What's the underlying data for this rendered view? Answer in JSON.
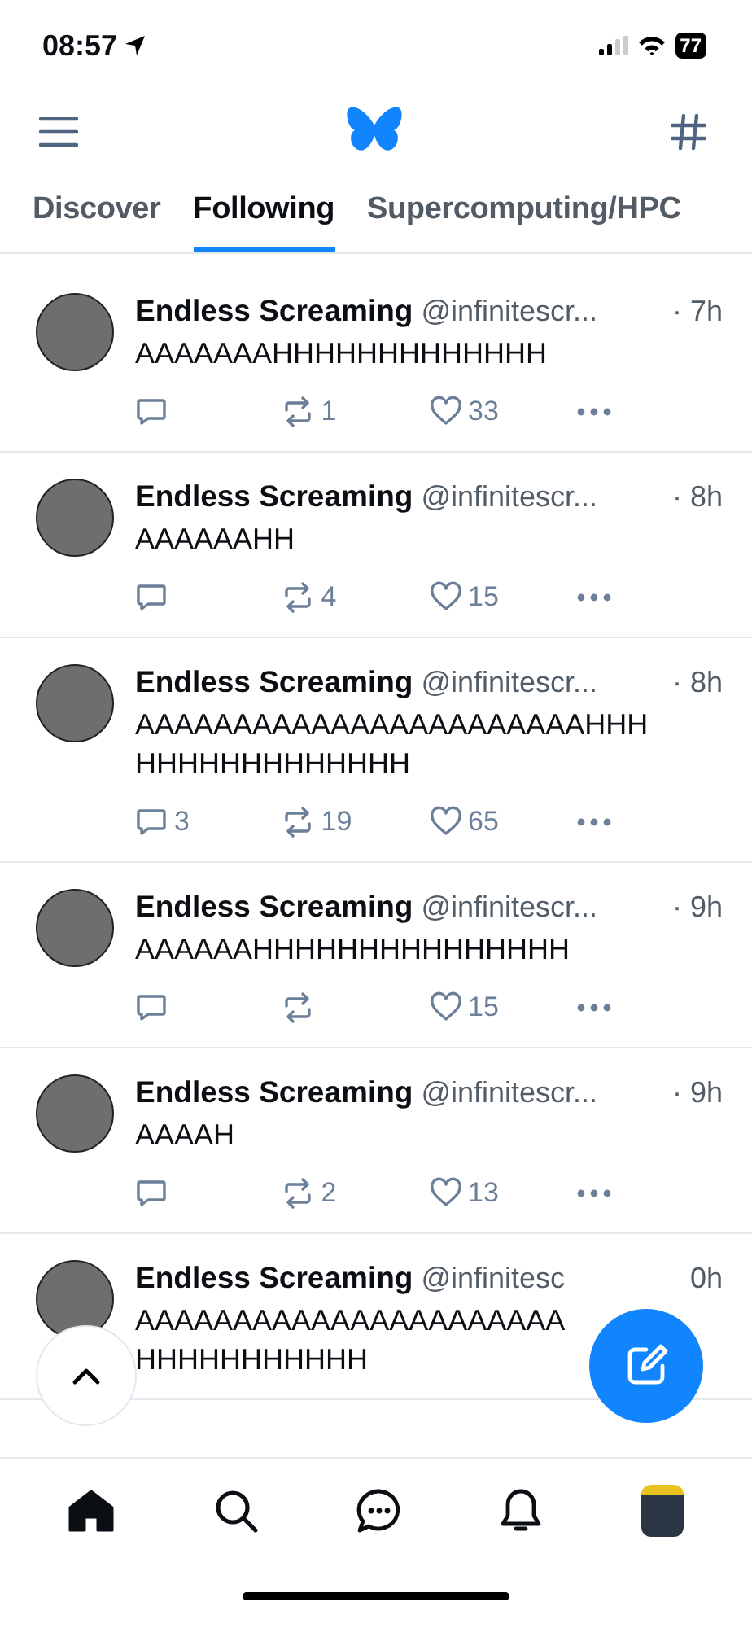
{
  "status_bar": {
    "time": "08:57",
    "battery": "77"
  },
  "tabs": [
    {
      "label": "Discover",
      "selected": false
    },
    {
      "label": "Following",
      "selected": true
    },
    {
      "label": "Supercomputing/HPC",
      "selected": false
    }
  ],
  "posts": [
    {
      "name": "Endless Screaming",
      "handle": "@infinitescr...",
      "time": "· 7h",
      "text": "AAAAAAAHHHHHHHHHHHHH",
      "reposts": "1",
      "likes": "33"
    },
    {
      "name": "Endless Screaming",
      "handle": "@infinitescr...",
      "time": "· 8h",
      "text": "AAAAAAHH",
      "reposts": "4",
      "likes": "15"
    },
    {
      "name": "Endless Screaming",
      "handle": "@infinitescr...",
      "time": "· 8h",
      "text": "AAAAAAAAAAAAAAAAAAAAAAAHHH HHHHHHHHHHHHH",
      "replies": "3",
      "reposts": "19",
      "likes": "65"
    },
    {
      "name": "Endless Screaming",
      "handle": "@infinitescr...",
      "time": "· 9h",
      "text": "AAAAAAHHHHHHHHHHHHHHH",
      "likes": "15"
    },
    {
      "name": "Endless Screaming",
      "handle": "@infinitescr...",
      "time": "· 9h",
      "text": "AAAAH",
      "reposts": "2",
      "likes": "13"
    },
    {
      "name": "Endless Screaming",
      "handle": "@infinitesc",
      "time": "0h",
      "text": "AAAAAAAAAAAAAAAAAAAAAA HHHHHHHHHHH"
    }
  ]
}
